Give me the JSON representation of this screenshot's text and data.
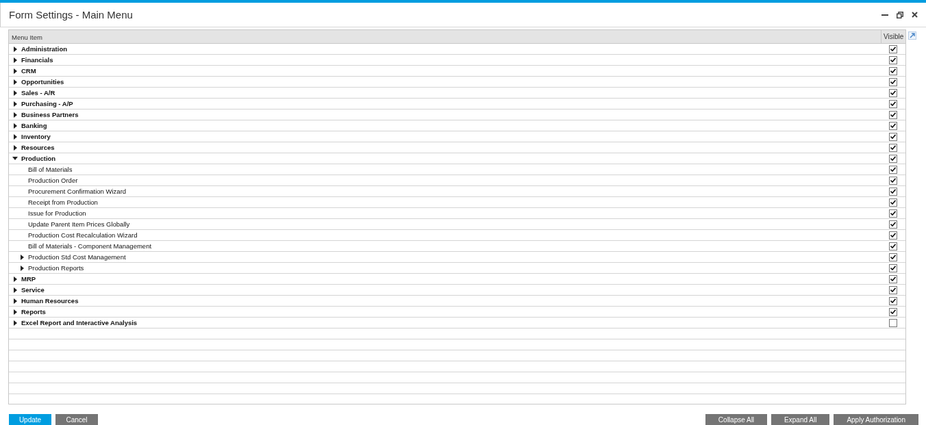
{
  "window": {
    "title": "Form Settings - Main Menu"
  },
  "table": {
    "columns": [
      "Menu Item",
      "Visible"
    ],
    "rows": [
      {
        "kind": "folder",
        "label": "Administration",
        "expanded": false,
        "checked": true
      },
      {
        "kind": "folder",
        "label": "Financials",
        "expanded": false,
        "checked": true
      },
      {
        "kind": "folder",
        "label": "CRM",
        "expanded": false,
        "checked": true
      },
      {
        "kind": "folder",
        "label": "Opportunities",
        "expanded": false,
        "checked": true
      },
      {
        "kind": "folder",
        "label": "Sales - A/R",
        "expanded": false,
        "checked": true
      },
      {
        "kind": "folder",
        "label": "Purchasing - A/P",
        "expanded": false,
        "checked": true
      },
      {
        "kind": "folder",
        "label": "Business Partners",
        "expanded": false,
        "checked": true
      },
      {
        "kind": "folder",
        "label": "Banking",
        "expanded": false,
        "checked": true
      },
      {
        "kind": "folder",
        "label": "Inventory",
        "expanded": false,
        "checked": true
      },
      {
        "kind": "folder",
        "label": "Resources",
        "expanded": false,
        "checked": true
      },
      {
        "kind": "folder",
        "label": "Production",
        "expanded": true,
        "checked": true,
        "children": [
          {
            "kind": "leaf",
            "label": "Bill of Materials",
            "checked": true
          },
          {
            "kind": "leaf",
            "label": "Production Order",
            "checked": true
          },
          {
            "kind": "leaf",
            "label": "Procurement Confirmation Wizard",
            "checked": true
          },
          {
            "kind": "leaf",
            "label": "Receipt from Production",
            "checked": true
          },
          {
            "kind": "leaf",
            "label": "Issue for Production",
            "checked": true
          },
          {
            "kind": "leaf",
            "label": "Update Parent Item Prices Globally",
            "checked": true
          },
          {
            "kind": "leaf",
            "label": "Production Cost Recalculation Wizard",
            "checked": true
          },
          {
            "kind": "leaf",
            "label": "Bill of Materials - Component Management",
            "checked": true
          },
          {
            "kind": "folder",
            "label": "Production Std Cost Management",
            "expanded": false,
            "checked": true
          },
          {
            "kind": "folder",
            "label": "Production Reports",
            "expanded": false,
            "checked": true
          }
        ]
      },
      {
        "kind": "folder",
        "label": "MRP",
        "expanded": false,
        "checked": true
      },
      {
        "kind": "folder",
        "label": "Service",
        "expanded": false,
        "checked": true
      },
      {
        "kind": "folder",
        "label": "Human Resources",
        "expanded": false,
        "checked": true
      },
      {
        "kind": "folder",
        "label": "Reports",
        "expanded": false,
        "checked": true
      },
      {
        "kind": "folder",
        "label": "Excel Report and Interactive Analysis",
        "expanded": false,
        "checked": false
      }
    ]
  },
  "buttons_left": [
    {
      "label": "Update",
      "kind": "primary"
    },
    {
      "label": "Cancel",
      "kind": "secondary"
    }
  ],
  "buttons_right": [
    {
      "label": "Collapse All",
      "kind": "secondary"
    },
    {
      "label": "Expand All",
      "kind": "secondary"
    },
    {
      "label": "Apply Authorization",
      "kind": "secondary"
    }
  ]
}
